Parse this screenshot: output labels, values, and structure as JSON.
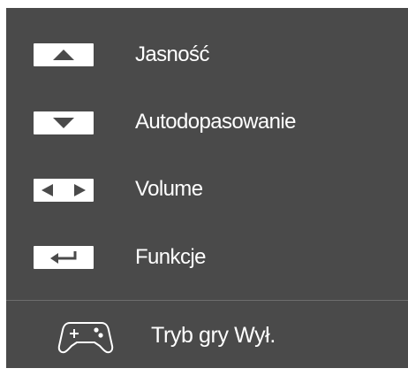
{
  "menu": {
    "items": [
      {
        "label": "Jasność",
        "icon": "triangle-up-icon"
      },
      {
        "label": "Autodopasowanie",
        "icon": "triangle-down-icon"
      },
      {
        "label": "Volume",
        "icon": "left-right-arrows-icon"
      },
      {
        "label": "Funkcje",
        "icon": "enter-return-icon"
      }
    ],
    "game_mode": {
      "label": "Tryb gry Wył.",
      "icon": "gamepad-icon"
    }
  },
  "colors": {
    "panel_background": "#4a4a4a",
    "key_background": "#ffffff",
    "icon_glyph": "#4a4a4a",
    "text": "#ffffff"
  }
}
